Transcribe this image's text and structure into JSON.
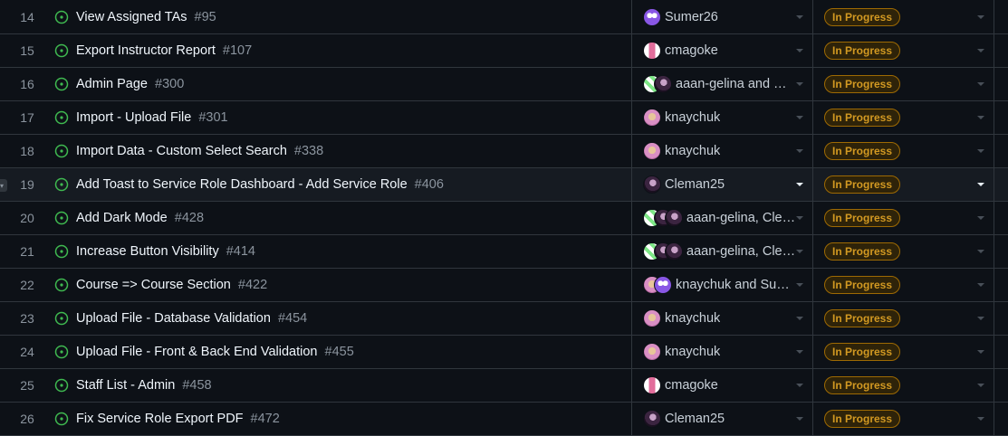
{
  "colors": {
    "background": "#0d1117",
    "border": "#30363d",
    "open_icon": "#3fb950",
    "badge_text": "#d29922",
    "badge_border": "#9e6a03"
  },
  "rows": [
    {
      "num": "14",
      "title": "View Assigned TAs",
      "issue": "#95",
      "assignee": "Sumer26",
      "avatars": [
        "purple-pattern"
      ],
      "status": "In Progress"
    },
    {
      "num": "15",
      "title": "Export Instructor Report",
      "issue": "#107",
      "assignee": "cmagoke",
      "avatars": [
        "pink-pattern"
      ],
      "status": "In Progress"
    },
    {
      "num": "16",
      "title": "Admin Page",
      "issue": "#300",
      "assignee": "aaan-gelina and Cl…",
      "avatars": [
        "green-pattern",
        "photo-dark"
      ],
      "status": "In Progress"
    },
    {
      "num": "17",
      "title": "Import - Upload File",
      "issue": "#301",
      "assignee": "knaychuk",
      "avatars": [
        "photo-pink"
      ],
      "status": "In Progress"
    },
    {
      "num": "18",
      "title": "Import Data - Custom Select Search",
      "issue": "#338",
      "assignee": "knaychuk",
      "avatars": [
        "photo-pink"
      ],
      "status": "In Progress"
    },
    {
      "num": "19",
      "title": "Add Toast to Service Role Dashboard - Add Service Role",
      "issue": "#406",
      "assignee": "Cleman25",
      "avatars": [
        "photo-dark"
      ],
      "status": "In Progress",
      "hover": true
    },
    {
      "num": "20",
      "title": "Add Dark Mode",
      "issue": "#428",
      "assignee": "aaan-gelina, Clem…",
      "avatars": [
        "green-pattern",
        "photo-dark",
        "photo-dark"
      ],
      "status": "In Progress"
    },
    {
      "num": "21",
      "title": "Increase Button Visibility",
      "issue": "#414",
      "assignee": "aaan-gelina, Clem…",
      "avatars": [
        "green-pattern",
        "photo-dark",
        "photo-dark"
      ],
      "status": "In Progress"
    },
    {
      "num": "22",
      "title": "Course => Course Section",
      "issue": "#422",
      "assignee": "knaychuk and Sum…",
      "avatars": [
        "photo-pink",
        "purple-pattern"
      ],
      "status": "In Progress"
    },
    {
      "num": "23",
      "title": "Upload File - Database Validation",
      "issue": "#454",
      "assignee": "knaychuk",
      "avatars": [
        "photo-pink"
      ],
      "status": "In Progress"
    },
    {
      "num": "24",
      "title": "Upload File - Front & Back End Validation",
      "issue": "#455",
      "assignee": "knaychuk",
      "avatars": [
        "photo-pink"
      ],
      "status": "In Progress"
    },
    {
      "num": "25",
      "title": "Staff List - Admin",
      "issue": "#458",
      "assignee": "cmagoke",
      "avatars": [
        "pink-pattern"
      ],
      "status": "In Progress"
    },
    {
      "num": "26",
      "title": "Fix Service Role Export PDF",
      "issue": "#472",
      "assignee": "Cleman25",
      "avatars": [
        "photo-dark"
      ],
      "status": "In Progress"
    }
  ]
}
